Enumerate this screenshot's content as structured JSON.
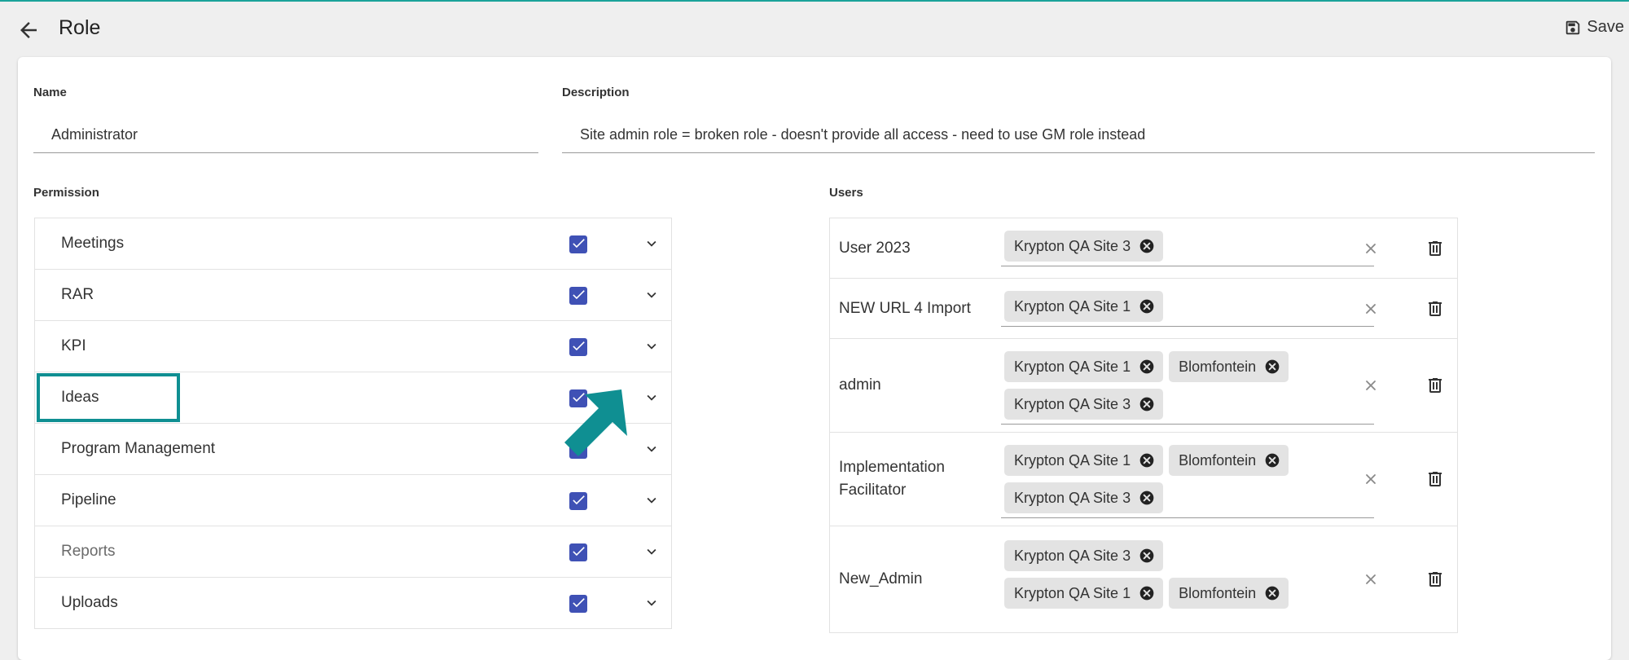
{
  "header": {
    "title": "Role",
    "save_label": "Save"
  },
  "form": {
    "name_label": "Name",
    "name_value": "Administrator",
    "description_label": "Description",
    "description_value": "Site admin role = broken role - doesn't provide all access - need to use GM role instead"
  },
  "permissions": {
    "label": "Permission",
    "items": [
      {
        "label": "Meetings",
        "checked": true
      },
      {
        "label": "RAR",
        "checked": true
      },
      {
        "label": "KPI",
        "checked": true
      },
      {
        "label": "Ideas",
        "checked": true
      },
      {
        "label": "Program Management",
        "checked": true
      },
      {
        "label": "Pipeline",
        "checked": true
      },
      {
        "label": "Reports",
        "checked": true
      },
      {
        "label": "Uploads",
        "checked": true
      }
    ]
  },
  "users": {
    "label": "Users",
    "rows": [
      {
        "name": "User 2023",
        "chips": [
          "Krypton QA Site 3"
        ]
      },
      {
        "name": "NEW URL 4 Import",
        "chips": [
          "Krypton QA Site 1"
        ]
      },
      {
        "name": "admin",
        "chips": [
          "Krypton QA Site 1",
          "Blomfontein",
          "Krypton QA Site 3"
        ]
      },
      {
        "name": "Implementation Facilitator",
        "chips": [
          "Krypton QA Site 1",
          "Blomfontein",
          "Krypton QA Site 3"
        ]
      },
      {
        "name": "New_Admin",
        "chips": [
          "Krypton QA Site 3",
          "Krypton QA Site 1",
          "Blomfontein"
        ]
      }
    ]
  },
  "colors": {
    "accent": "#3f51b5",
    "annotation": "#0f8f92",
    "background": "#efefef"
  },
  "icons": {
    "back": "arrow-left-icon",
    "save": "floppy-disk-icon",
    "chevron": "chevron-down-icon",
    "check": "checkbox-checked-icon",
    "chip_remove": "close-circle-icon",
    "clear": "close-icon",
    "delete": "trash-icon"
  }
}
